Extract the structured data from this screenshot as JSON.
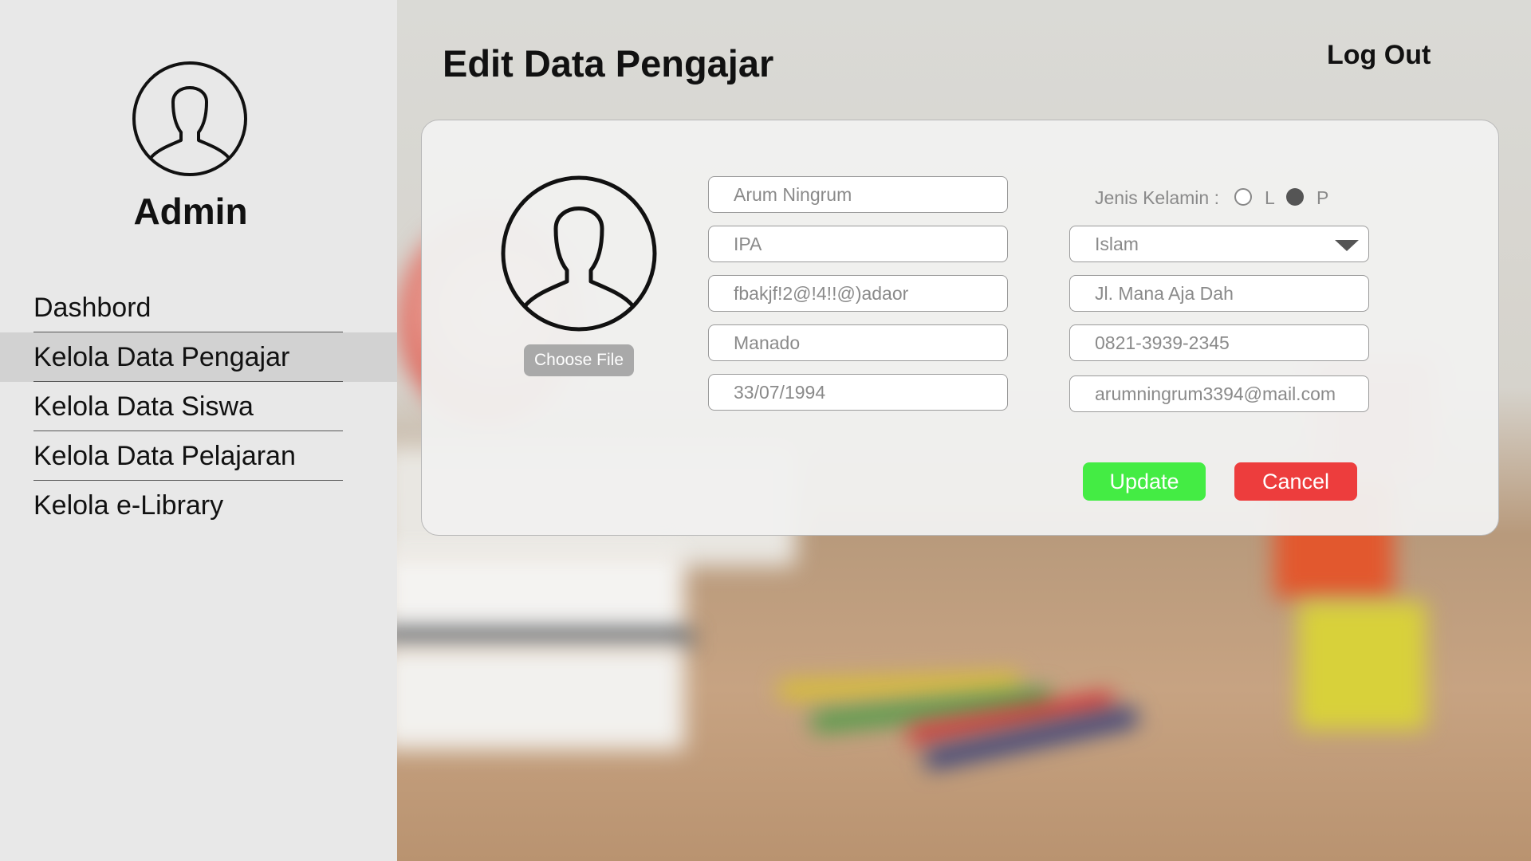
{
  "sidebar": {
    "user_label": "Admin",
    "nav": [
      {
        "label": "Dashbord",
        "active": false
      },
      {
        "label": "Kelola Data Pengajar",
        "active": true
      },
      {
        "label": "Kelola Data Siswa",
        "active": false
      },
      {
        "label": "Kelola Data Pelajaran",
        "active": false
      },
      {
        "label": "Kelola e-Library",
        "active": false
      }
    ]
  },
  "header": {
    "title": "Edit Data Pengajar",
    "logout_label": "Log Out"
  },
  "form": {
    "choose_file_label": "Choose File",
    "nama": "Arum Ningrum",
    "mapel": "IPA",
    "password": "fbakjf!2@!4!!@)adaor",
    "tempat_lahir": "Manado",
    "tanggal_lahir": "33/07/1994",
    "gender_label": "Jenis Kelamin :",
    "gender_options": [
      "L",
      "P"
    ],
    "gender_selected": "P",
    "agama": "Islam",
    "alamat": "Jl. Mana Aja Dah",
    "telepon": "0821-3939-2345",
    "email": "arumningrum3394@mail.com",
    "update_label": "Update",
    "cancel_label": "Cancel"
  },
  "colors": {
    "update_button": "#44ec44",
    "cancel_button": "#ed3d3d",
    "sidebar_bg": "#e8e8e8",
    "active_nav_bg": "#d2d2d2"
  }
}
